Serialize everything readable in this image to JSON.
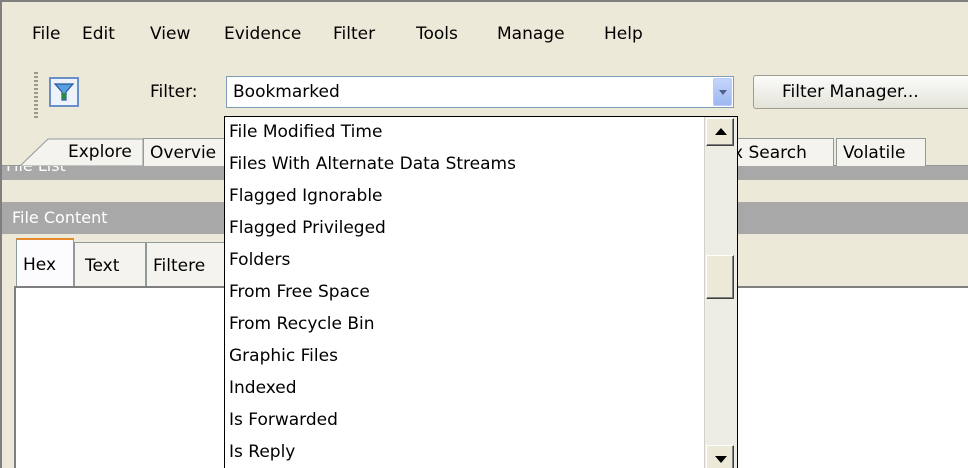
{
  "menu": [
    {
      "label": "File"
    },
    {
      "label": "Edit"
    },
    {
      "label": "View"
    },
    {
      "label": "Evidence"
    },
    {
      "label": "Filter"
    },
    {
      "label": "Tools"
    },
    {
      "label": "Manage"
    },
    {
      "label": "Help"
    }
  ],
  "toolbar": {
    "filter_icon": "funnel-icon",
    "filter_label": "Filter:",
    "filter_value": "Bookmarked",
    "filter_manager_label": "Filter Manager..."
  },
  "tabs": [
    {
      "label": "Explore"
    },
    {
      "label": "Overvie"
    },
    {
      "label": "x Search"
    },
    {
      "label": "Volatile"
    }
  ],
  "panels": {
    "file_list_title": "File List",
    "file_content_title": "File Content",
    "content_tabs": [
      {
        "label": "Hex"
      },
      {
        "label": "Text"
      },
      {
        "label": "Filtere"
      }
    ]
  },
  "dropdown": {
    "options": [
      "File Modified Time",
      "Files With Alternate Data Streams",
      "Flagged Ignorable",
      "Flagged Privileged",
      "Folders",
      "From Free Space",
      "From Recycle Bin",
      "Graphic Files",
      "Indexed",
      "Is Forwarded",
      "Is Reply"
    ]
  },
  "colors": {
    "window_bg": "#ece9d8",
    "panel_title_bg": "#a8a8a8",
    "active_tab_accent": "#e68b2c",
    "combo_border": "#7f9db9"
  }
}
